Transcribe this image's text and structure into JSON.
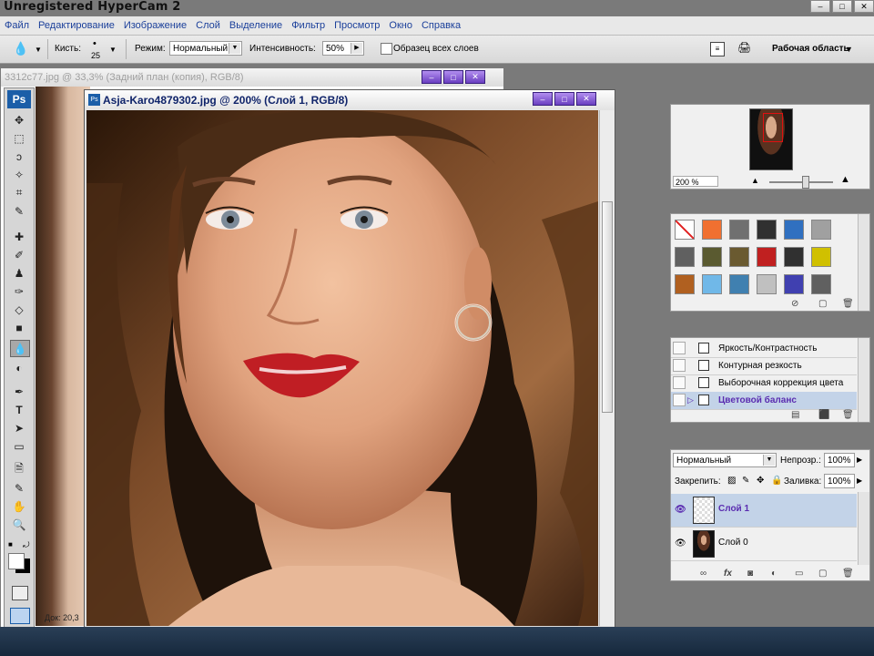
{
  "watermark": "Unregistered HyperCam 2",
  "menu": [
    "Файл",
    "Редактирование",
    "Изображение",
    "Слой",
    "Выделение",
    "Фильтр",
    "Просмотр",
    "Окно",
    "Справка"
  ],
  "options": {
    "brush_label": "Кисть:",
    "brush_size": "25",
    "mode_label": "Режим:",
    "mode_value": "Нормальный",
    "intensity_label": "Интенсивность:",
    "intensity_value": "50%",
    "sample_all_label": "Образец всех слоев",
    "workspace_label": "Рабочая область"
  },
  "tools": {
    "logo": "Ps",
    "items": [
      "move",
      "marquee",
      "lasso",
      "magic-wand",
      "crop",
      "slice",
      "healing",
      "brush",
      "stamp",
      "history-brush",
      "eraser",
      "gradient",
      "blur",
      "dodge",
      "pen",
      "type",
      "path-select",
      "shape",
      "notes",
      "eyedropper",
      "hand",
      "zoom"
    ]
  },
  "bg_document": {
    "title": "3312c77.jpg @ 33,3% (Задний план (копия), RGB/8)",
    "status": "Док: 20,3"
  },
  "main_document": {
    "title": "Asja-Karo4879302.jpg @ 200% (Слой 1, RGB/8)"
  },
  "navigator": {
    "zoom": "200 %"
  },
  "styles": {
    "swatches": [
      "#ffffff",
      "#f07030",
      "#707070",
      "#303030",
      "#3070c0",
      "#a0a0a0",
      "#606060",
      "#5a5a30",
      "#6a5a30",
      "#c02020",
      "#303030",
      "#d0c000",
      "#b06020",
      "#70b8e8",
      "#4080b0",
      "#c0c0c0",
      "#4040b0",
      "#606060"
    ]
  },
  "actions": {
    "items": [
      {
        "label": "Яркость/Контрастность",
        "selected": false
      },
      {
        "label": "Контурная резкость",
        "selected": false
      },
      {
        "label": "Выборочная коррекция цвета",
        "selected": false
      },
      {
        "label": "Цветовой баланс",
        "selected": true
      }
    ]
  },
  "layers": {
    "blend_mode": "Нормальный",
    "opacity_label": "Непрозр.:",
    "opacity_value": "100%",
    "lock_label": "Закрепить:",
    "fill_label": "Заливка:",
    "fill_value": "100%",
    "items": [
      {
        "name": "Слой 1",
        "selected": true
      },
      {
        "name": "Слой 0",
        "selected": false
      }
    ]
  },
  "colors": {
    "accent_selected": "#c3d3e8",
    "selected_text": "#5a2cb0",
    "window_control": "#7a50d0",
    "menu_text": "#1a3f9a"
  }
}
